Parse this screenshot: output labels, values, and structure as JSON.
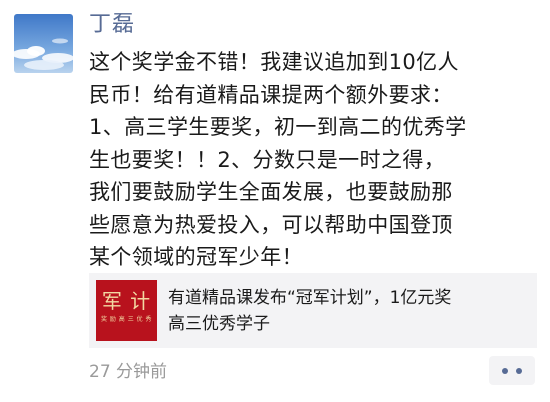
{
  "post": {
    "username": "丁磊",
    "text_lines": [
      "这个奖学金不错！我建议追加到10亿人",
      "民币！给有道精品课提两个额外要求：",
      "1、高三学生要奖，初一到高二的优秀学",
      "生也要奖！！2、分数只是一时之得，",
      "我们要鼓励学生全面发展，也要鼓励那",
      "些愿意为热爱投入，可以帮助中国登顶",
      "某个领域的冠军少年！"
    ],
    "timestamp": "27 分钟前"
  },
  "avatar": {
    "icon": "sky-clouds-avatar",
    "colors": [
      "#5d8fd1",
      "#b9d3ee",
      "#ffffff"
    ]
  },
  "link_card": {
    "title_lines": [
      "有道精品课发布“冠军计划”，1亿元奖",
      "高三优秀学子"
    ],
    "thumbnail": {
      "main_text": "军 计",
      "sub_text": "奖 励 高 三 优 秀",
      "background": "#b8121d",
      "text_color": "#f3d9a3"
    }
  },
  "actions": {
    "more_icon": "two-dots-comment-icon"
  },
  "colors": {
    "name": "#576b95",
    "body_text": "#1a1a1a",
    "timestamp": "#9a9a9a",
    "card_bg": "#f3f3f5"
  }
}
